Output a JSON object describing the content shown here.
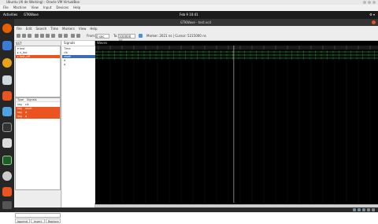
{
  "host_window": {
    "title": "Ubuntu (Al de Working) - Oracle VM VirtualBox",
    "menu": [
      "File",
      "Machine",
      "View",
      "Input",
      "Devices",
      "Help"
    ]
  },
  "guest_topbar": {
    "activities": "Activities",
    "app_name": "GTKWave",
    "clock": "Feb 9 10:41"
  },
  "gtkwave": {
    "window_title": "GTKWave - test.vcd",
    "menu": [
      "File",
      "Edit",
      "Search",
      "Time",
      "Markers",
      "View",
      "Help"
    ],
    "toolbar": {
      "from_label": "From:",
      "from_value": "0 sec",
      "to_label": "To:",
      "to_value": "100000 ns",
      "marker_text": "Marker: 2021 ns | Cursor: 5215000 ns"
    },
    "sst": {
      "label": "SST",
      "tree": [
        {
          "label": "▾ test",
          "selected": false
        },
        {
          "label": "  ▸ u_dut",
          "selected": false
        },
        {
          "label": "    ▸ test_dff",
          "selected": true
        }
      ],
      "list_header": {
        "type": "Type",
        "signals": "Signals"
      },
      "list": [
        {
          "type": "reg",
          "name": "clk",
          "selected": false
        },
        {
          "type": "reg",
          "name": "reset",
          "selected": true
        },
        {
          "type": "reg",
          "name": "d",
          "selected": true
        },
        {
          "type": "reg",
          "name": "q",
          "selected": true
        }
      ],
      "filter_label": "Filter:",
      "filter_value": "",
      "buttons": [
        "Append",
        "Insert",
        "Replace"
      ]
    },
    "signals": {
      "label": "Signals",
      "rows": [
        {
          "label": "Time",
          "selected": false
        },
        {
          "label": "clk",
          "selected": false
        },
        {
          "label": "reset",
          "selected": true
        },
        {
          "label": "d",
          "selected": false
        },
        {
          "label": "q",
          "selected": false
        }
      ]
    },
    "waves": {
      "label": "Waves",
      "marker_fraction": 0.49
    }
  }
}
